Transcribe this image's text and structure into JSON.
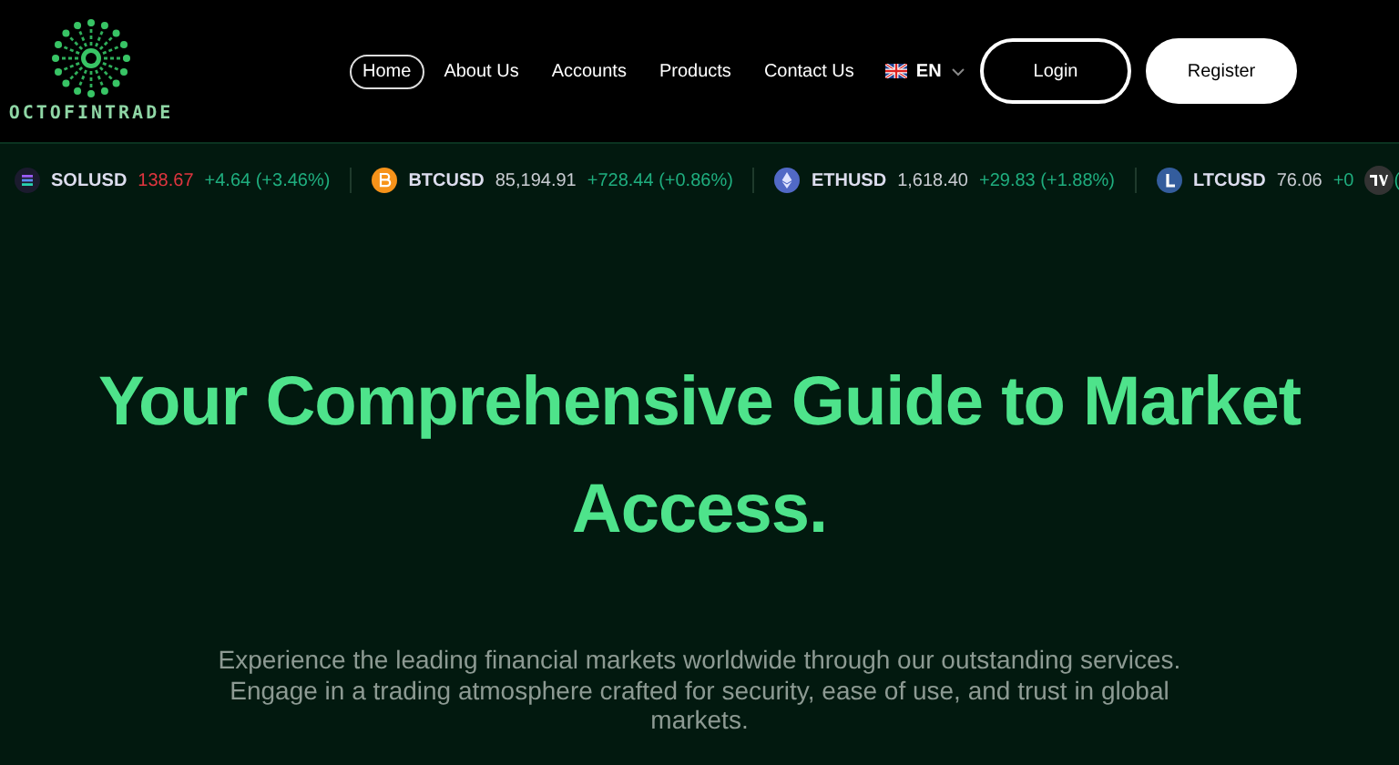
{
  "brand": {
    "name": "OCTOFINTRADE"
  },
  "nav": [
    {
      "label": "Home",
      "selected": true
    },
    {
      "label": "About Us",
      "selected": false
    },
    {
      "label": "Accounts",
      "selected": false
    },
    {
      "label": "Products",
      "selected": false
    },
    {
      "label": "Contact Us",
      "selected": false
    }
  ],
  "language": {
    "code": "EN"
  },
  "buttons": [
    {
      "label": "Login",
      "kind": "outline"
    },
    {
      "label": "Register",
      "kind": "solid"
    }
  ],
  "ticker": [
    {
      "symbol": "SOLUSD",
      "price": "138.67",
      "price_down": true,
      "change": "+4.64 (+3.46%)",
      "kind": "sol"
    },
    {
      "symbol": "BTCUSD",
      "price": "85,194.91",
      "price_down": false,
      "change": "+728.44 (+0.86%)",
      "kind": "btc"
    },
    {
      "symbol": "ETHUSD",
      "price": "1,618.40",
      "price_down": false,
      "change": "+29.83 (+1.88%)",
      "kind": "eth"
    },
    {
      "symbol": "LTCUSD",
      "price": "76.06",
      "price_down": false,
      "change": "+0",
      "tail": "(",
      "kind": "ltc"
    }
  ],
  "hero": {
    "title": "Your Comprehensive Guide to Market Access.",
    "subtitle": "Experience the leading financial markets worldwide through our outstanding services. Engage in a trading atmosphere crafted for security, ease of use, and trust in global markets."
  }
}
